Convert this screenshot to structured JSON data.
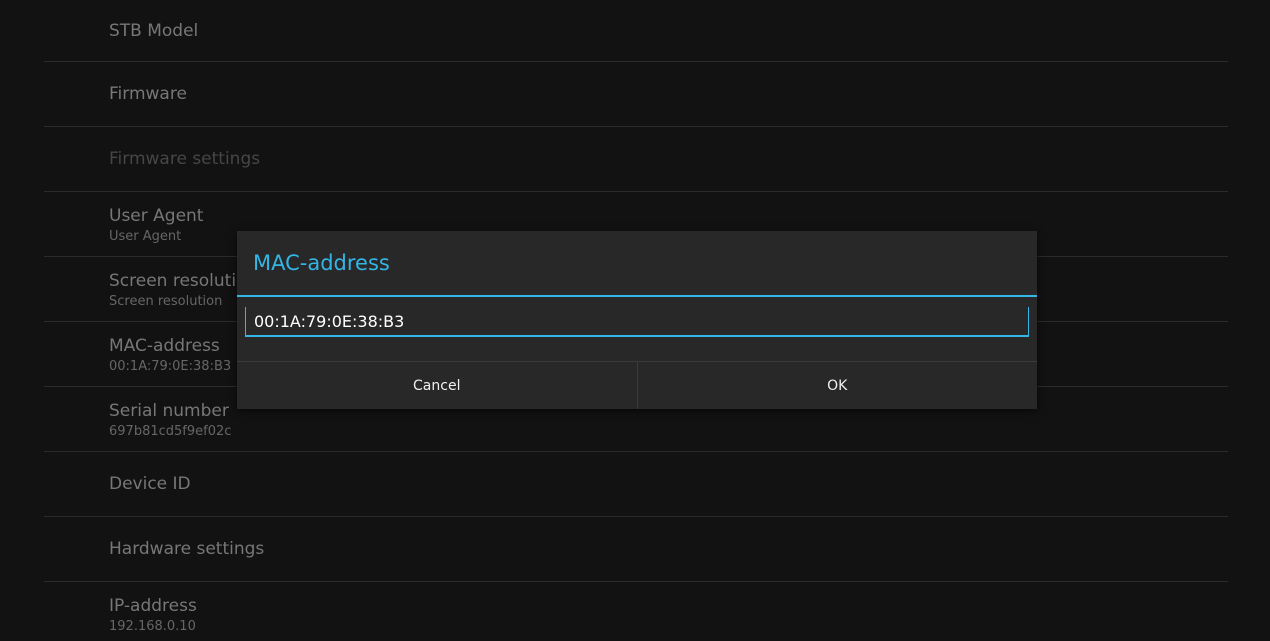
{
  "settings": {
    "items": [
      {
        "title": "STB Model",
        "summary": ""
      },
      {
        "title": "Firmware",
        "summary": ""
      },
      {
        "title": "Firmware settings",
        "summary": ""
      },
      {
        "title": "User Agent",
        "summary": "User Agent"
      },
      {
        "title": "Screen resolution",
        "summary": "Screen resolution"
      },
      {
        "title": "MAC-address",
        "summary": "00:1A:79:0E:38:B3"
      },
      {
        "title": "Serial number",
        "summary": "697b81cd5f9ef02c"
      },
      {
        "title": "Device ID",
        "summary": ""
      },
      {
        "title": "Hardware settings",
        "summary": ""
      },
      {
        "title": "IP-address",
        "summary": "192.168.0.10"
      }
    ]
  },
  "dialog": {
    "title": "MAC-address",
    "input_value": "00:1A:79:0E:38:B3",
    "cancel_label": "Cancel",
    "ok_label": "OK"
  },
  "colors": {
    "accent": "#33b5e5",
    "background": "#121212",
    "dialog_background": "#282828"
  }
}
